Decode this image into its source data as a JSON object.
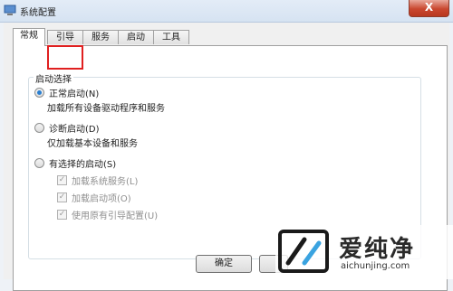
{
  "window": {
    "title": "系统配置",
    "close_label": "X"
  },
  "tabs": [
    {
      "label": "常规",
      "active": true
    },
    {
      "label": "引导",
      "active": false
    },
    {
      "label": "服务",
      "active": false
    },
    {
      "label": "启动",
      "active": false
    },
    {
      "label": "工具",
      "active": false
    }
  ],
  "startup_selection": {
    "legend": "启动选择",
    "options": [
      {
        "label": "正常启动(N)",
        "description": "加载所有设备驱动程序和服务",
        "checked": true
      },
      {
        "label": "诊断启动(D)",
        "description": "仅加载基本设备和服务",
        "checked": false
      },
      {
        "label": "有选择的启动(S)",
        "checked": false
      }
    ],
    "selective_items": [
      {
        "label": "加载系统服务(L)",
        "checked": true
      },
      {
        "label": "加载启动项(O)",
        "checked": true
      },
      {
        "label": "使用原有引导配置(U)",
        "checked": true
      }
    ]
  },
  "buttons": {
    "ok": "确定"
  },
  "watermark": {
    "title": "爱纯净",
    "url": "aichunjing.com"
  },
  "colors": {
    "highlight": "#e02020",
    "radio_selected": "#2a7fd0"
  }
}
